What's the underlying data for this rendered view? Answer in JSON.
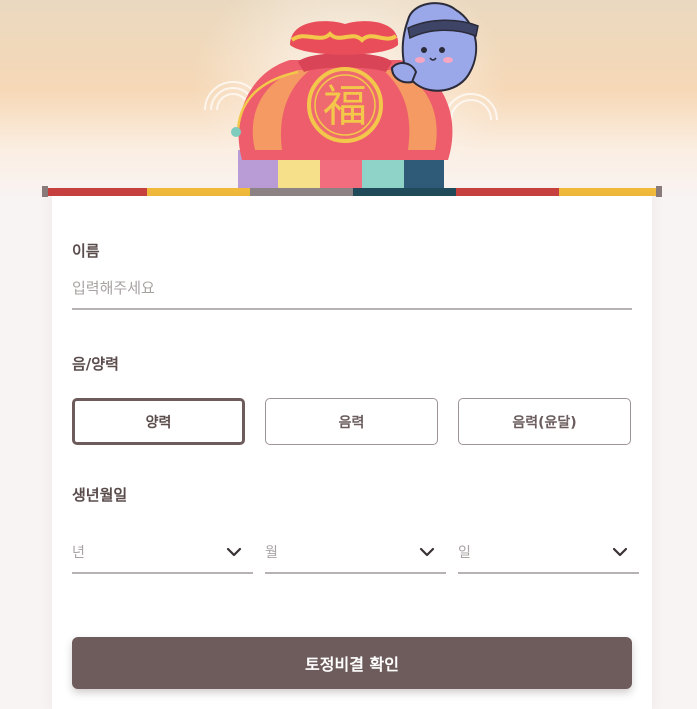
{
  "hero": {
    "emblem_char": "福",
    "palette": {
      "bag_top": "#e8505b",
      "bag_body": "#f06a6a",
      "gold": "#f3c84a",
      "mascot": "#9aa8ea"
    }
  },
  "band_colors": [
    "#c8403f",
    "#f2bb3b",
    "#8d8486",
    "#1f4b5a",
    "#c8403f",
    "#f2bb3b"
  ],
  "form": {
    "name": {
      "label": "이름",
      "placeholder": "입력해주세요",
      "value": ""
    },
    "calendar": {
      "label": "음/양력",
      "options": [
        "양력",
        "음력",
        "음력(윤달)"
      ],
      "selected": "양력"
    },
    "birth": {
      "label": "생년월일",
      "year_placeholder": "년",
      "month_placeholder": "월",
      "day_placeholder": "일"
    },
    "submit_label": "토정비결 확인"
  },
  "colors": {
    "primary": "#6e5c5c",
    "placeholder": "#a8a2a2",
    "line": "#b8b3b3"
  }
}
